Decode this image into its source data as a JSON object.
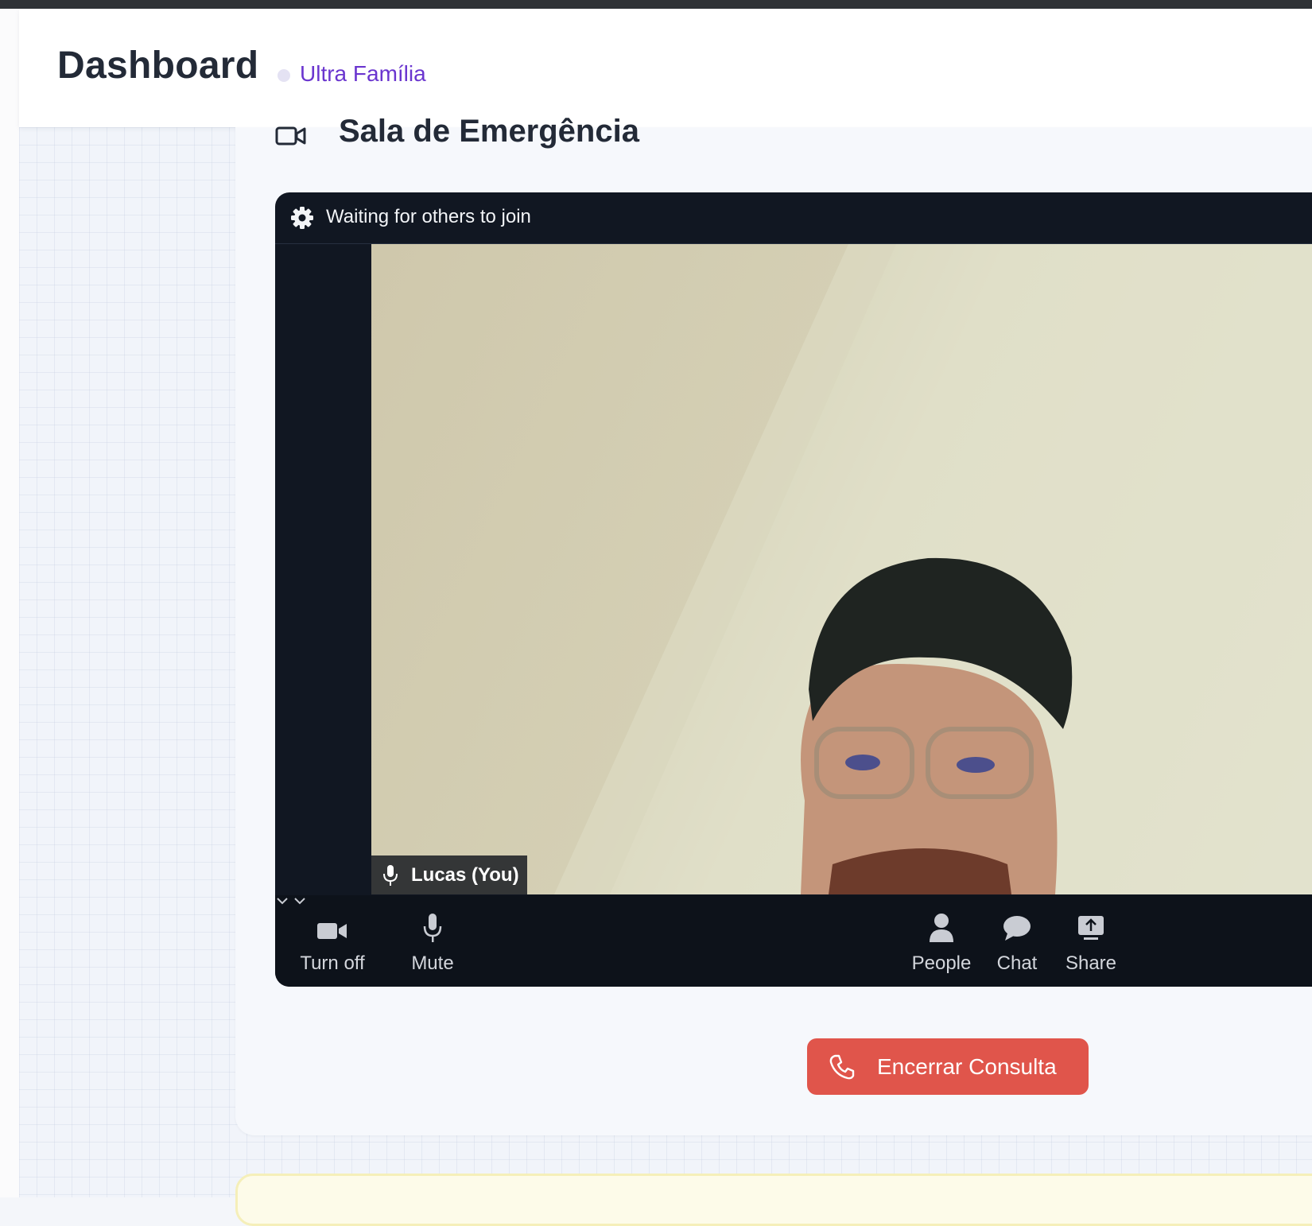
{
  "header": {
    "title": "Dashboard",
    "organization": "Ultra Família"
  },
  "room": {
    "title": "Sala de Emergência"
  },
  "call": {
    "status_text": "Waiting for others to join",
    "participant_label": "Lucas (You)",
    "controls": {
      "camera_label": "Turn off",
      "mic_label": "Mute",
      "people_label": "People",
      "chat_label": "Chat",
      "share_label": "Share"
    }
  },
  "actions": {
    "end_call_label": "Encerrar Consulta"
  },
  "colors": {
    "brand_purple": "#6a35cf",
    "end_button": "#e0554b",
    "call_background": "#111722"
  },
  "icons": [
    "video-camera-icon",
    "gear-icon",
    "microphone-icon",
    "chevron-down-icon",
    "person-icon",
    "chat-bubble-icon",
    "share-screen-icon",
    "phone-icon"
  ]
}
